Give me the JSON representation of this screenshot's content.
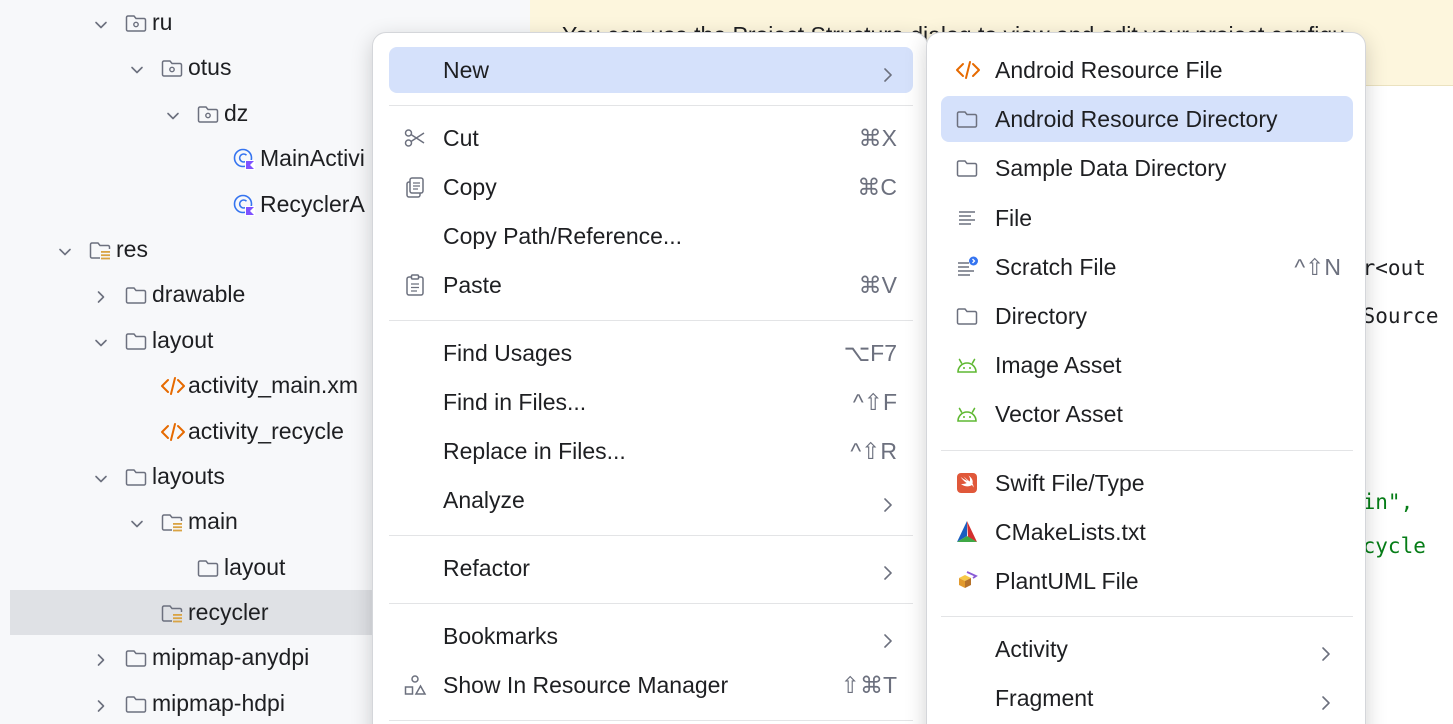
{
  "project_tree": {
    "items": [
      {
        "label": "ru",
        "depth": 0,
        "kind": "package",
        "expanded": true
      },
      {
        "label": "otus",
        "depth": 1,
        "kind": "package",
        "expanded": true
      },
      {
        "label": "dz",
        "depth": 2,
        "kind": "package",
        "expanded": true
      },
      {
        "label": "MainActivi",
        "depth": 3,
        "kind": "kotlin-class"
      },
      {
        "label": "RecyclerA",
        "depth": 3,
        "kind": "kotlin-class"
      },
      {
        "label": "res",
        "depth": -1,
        "kind": "res-folder",
        "expanded": true
      },
      {
        "label": "drawable",
        "depth": 0,
        "kind": "folder",
        "expanded": false
      },
      {
        "label": "layout",
        "depth": 0,
        "kind": "folder",
        "expanded": true
      },
      {
        "label": "activity_main.xm",
        "depth": 1,
        "kind": "xml"
      },
      {
        "label": "activity_recycle",
        "depth": 1,
        "kind": "xml"
      },
      {
        "label": "layouts",
        "depth": 0,
        "kind": "folder",
        "expanded": true
      },
      {
        "label": "main",
        "depth": 1,
        "kind": "res-folder",
        "expanded": true
      },
      {
        "label": "layout",
        "depth": 2,
        "kind": "folder"
      },
      {
        "label": "recycler",
        "depth": 1,
        "kind": "res-folder",
        "selected": true
      },
      {
        "label": "mipmap-anydpi",
        "depth": 0,
        "kind": "folder",
        "expanded": false
      },
      {
        "label": "mipmap-hdpi",
        "depth": 0,
        "kind": "folder",
        "expanded": false
      }
    ]
  },
  "editor": {
    "banner_text": "You can use the Project Structure dialog to view and edit your project configu",
    "code_lines": [
      "er<out",
      "lSource",
      "ain\",",
      "ecycle"
    ]
  },
  "context_menu": {
    "items": [
      {
        "label": "New",
        "icon": "",
        "shortcut": "",
        "submenu": true,
        "active": true
      },
      {
        "separator": true
      },
      {
        "label": "Cut",
        "icon": "scissors-icon",
        "shortcut": "⌘X"
      },
      {
        "label": "Copy",
        "icon": "copy-icon",
        "shortcut": "⌘C"
      },
      {
        "label": "Copy Path/Reference...",
        "icon": "",
        "shortcut": ""
      },
      {
        "label": "Paste",
        "icon": "clipboard-icon",
        "shortcut": "⌘V"
      },
      {
        "separator": true
      },
      {
        "label": "Find Usages",
        "icon": "",
        "shortcut": "⌥F7"
      },
      {
        "label": "Find in Files...",
        "icon": "",
        "shortcut": "^⇧F"
      },
      {
        "label": "Replace in Files...",
        "icon": "",
        "shortcut": "^⇧R"
      },
      {
        "label": "Analyze",
        "icon": "",
        "shortcut": "",
        "submenu": true
      },
      {
        "separator": true
      },
      {
        "label": "Refactor",
        "icon": "",
        "shortcut": "",
        "submenu": true
      },
      {
        "separator": true
      },
      {
        "label": "Bookmarks",
        "icon": "",
        "shortcut": "",
        "submenu": true
      },
      {
        "label": "Show In Resource Manager",
        "icon": "resource-manager-icon",
        "shortcut": "⇧⌘T"
      },
      {
        "separator": true
      }
    ]
  },
  "new_submenu": {
    "items": [
      {
        "label": "Android Resource File",
        "icon": "xml-icon"
      },
      {
        "label": "Android Resource Directory",
        "icon": "folder-icon",
        "active": true
      },
      {
        "label": "Sample Data Directory",
        "icon": "folder-icon"
      },
      {
        "label": "File",
        "icon": "text-file-icon"
      },
      {
        "label": "Scratch File",
        "icon": "scratch-file-icon",
        "shortcut": "^⇧N"
      },
      {
        "label": "Directory",
        "icon": "folder-icon"
      },
      {
        "label": "Image Asset",
        "icon": "android-icon"
      },
      {
        "label": "Vector Asset",
        "icon": "android-icon"
      },
      {
        "separator": true
      },
      {
        "label": "Swift File/Type",
        "icon": "swift-icon"
      },
      {
        "label": "CMakeLists.txt",
        "icon": "cmake-icon"
      },
      {
        "label": "PlantUML File",
        "icon": "plantuml-icon"
      },
      {
        "separator": true
      },
      {
        "label": "Activity",
        "icon": "",
        "submenu": true
      },
      {
        "label": "Fragment",
        "icon": "",
        "submenu": true
      }
    ]
  },
  "colors": {
    "selection": "#d5e1fb",
    "tree_selection": "#dfe1e5",
    "banner": "#fdf6dd",
    "xml_icon": "#e66a00",
    "android_icon": "#5fb832",
    "code_green": "#067d17"
  }
}
